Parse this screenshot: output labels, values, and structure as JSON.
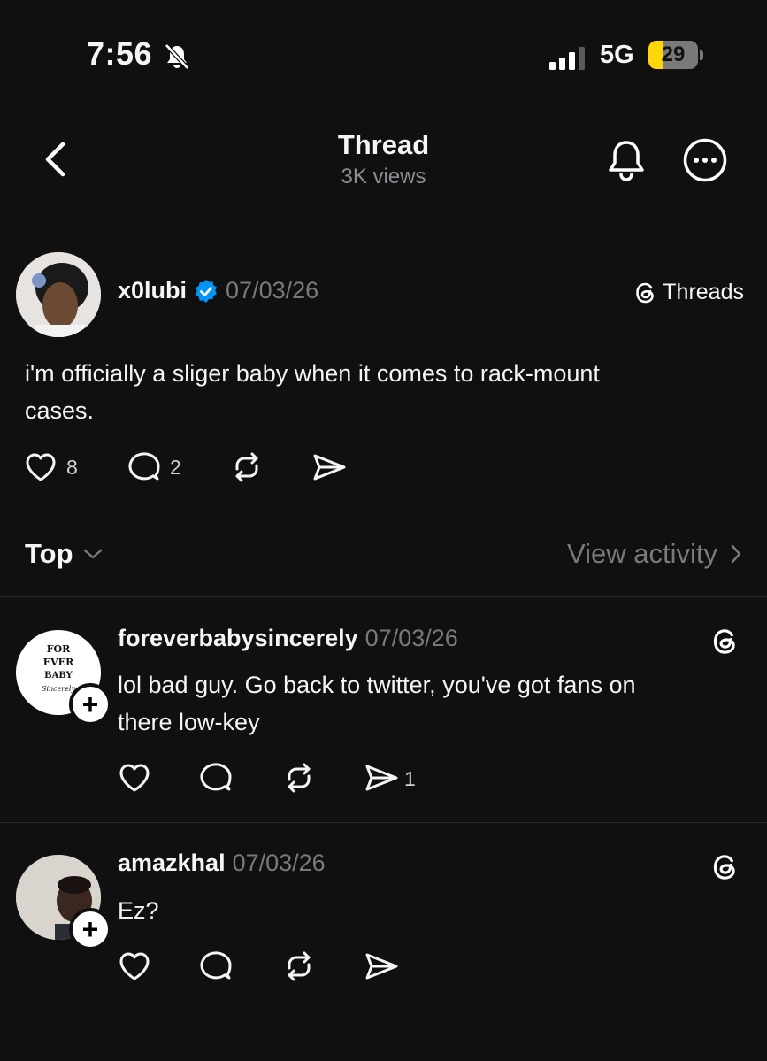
{
  "status_bar": {
    "time": "7:56",
    "network": "5G",
    "battery": "29",
    "battery_level": 0.29
  },
  "header": {
    "title": "Thread",
    "subtitle": "3K views"
  },
  "main_post": {
    "username": "x0lubi",
    "date": "07/03/26",
    "app_tag": "Threads",
    "text_line1": "i'm officially a sliger baby when it comes to rack-mount",
    "text_line2": "cases.",
    "likes": "8",
    "replies": "2"
  },
  "sort": {
    "label": "Top",
    "activity_label": "View activity"
  },
  "replies": [
    {
      "username": "foreverbabysincerely",
      "date": "07/03/26",
      "avatar_line1": "FOR",
      "avatar_line2": "EVER",
      "avatar_line3": "BABY",
      "avatar_line4": "Sincerely",
      "text_line1": "lol bad guy. Go back to twitter, you've got fans on",
      "text_line2": "there low-key",
      "shares": "1"
    },
    {
      "username": "amazkhal",
      "date": "07/03/26",
      "text_line1": "Ez?"
    }
  ],
  "plus": "+",
  "colors": {
    "background": "#101010",
    "verified": "#0095f6",
    "battery": "#ffd60a",
    "muted": "#77797c"
  }
}
